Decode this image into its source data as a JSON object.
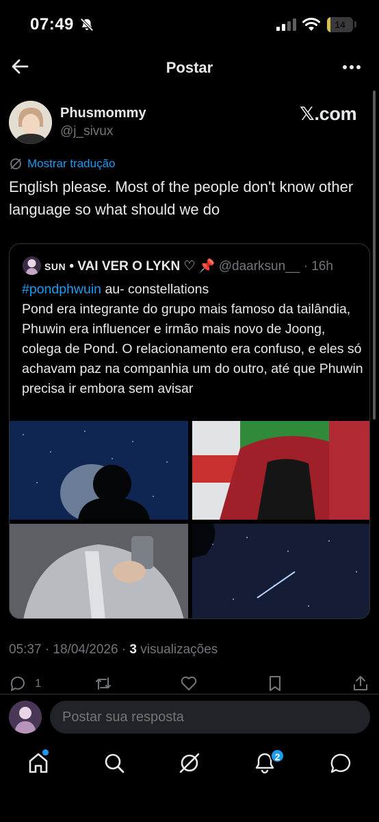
{
  "status_bar": {
    "time": "07:49",
    "battery": "14",
    "battery_level": 0.14
  },
  "header": {
    "title": "Postar"
  },
  "tweet": {
    "display_name": "Phusmommy",
    "handle": "@j_sivux",
    "source_badge": "𝕏.com",
    "translate_label": "Mostrar tradução",
    "text": "English please. Most of the people don't know other language so what should we do",
    "timestamp": "05:37 · 18/04/2026 · ",
    "views_count": "3",
    "views_label": " visualizações"
  },
  "quote": {
    "name_small": "SUN",
    "name_rest": " • VAI VER O LYKN ♡ 📌",
    "handle": " @daarksun__ · 16h",
    "hashtag": "#pondphwuin",
    "body_rest": " au- constellations",
    "body_line2": "Pond era integrante do grupo mais famoso da tailândia, Phuwin era influencer e irmão mais novo de Joong, colega de Pond. O relacionamento era confuso, e eles só achavam paz na companhia um do outro, até que Phuwin precisa ir embora sem avisar"
  },
  "actions": {
    "reply_count": "1"
  },
  "reply": {
    "placeholder": "Postar sua resposta"
  },
  "nav": {
    "notifications_badge": "2"
  },
  "colors": {
    "accent": "#1d9bf0",
    "background": "#000000",
    "muted": "#71767b",
    "text": "#e7e9ea"
  }
}
